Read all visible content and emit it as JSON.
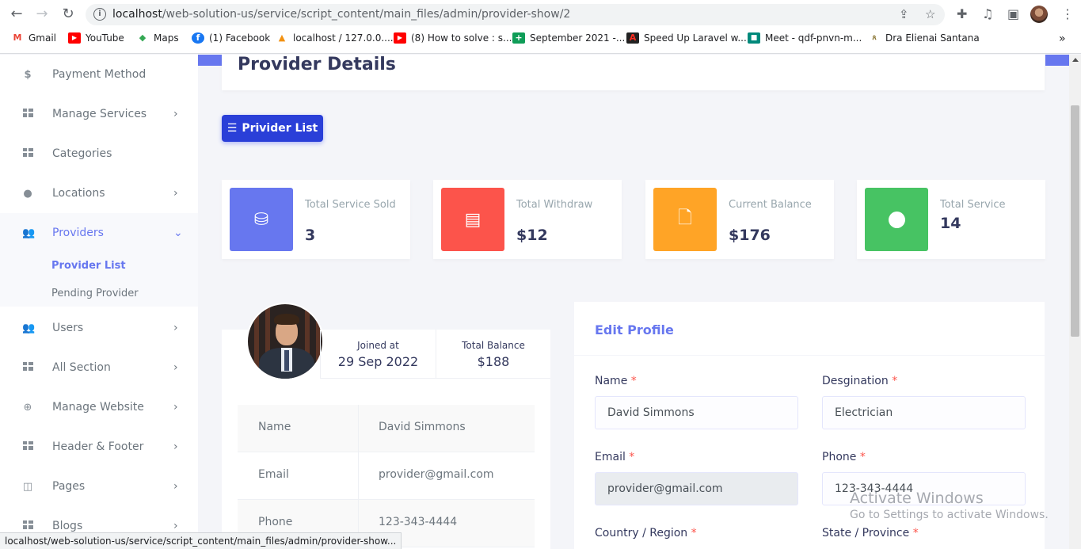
{
  "browser": {
    "url_host": "localhost",
    "url_path": "/web-solution-us/service/script_content/main_files/admin/provider-show/2",
    "bookmarks": [
      {
        "label": "Gmail",
        "icon": "gmail-icon"
      },
      {
        "label": "YouTube",
        "icon": "youtube-icon"
      },
      {
        "label": "Maps",
        "icon": "maps-icon"
      },
      {
        "label": "(1) Facebook",
        "icon": "facebook-icon"
      },
      {
        "label": "localhost / 127.0.0....",
        "icon": "phpmyadmin-icon"
      },
      {
        "label": "(8) How to solve : s...",
        "icon": "youtube-icon"
      },
      {
        "label": "September 2021 -...",
        "icon": "sheets-icon"
      },
      {
        "label": "Speed Up Laravel w...",
        "icon": "laravel-icon"
      },
      {
        "label": "Meet - qdf-pnvn-m...",
        "icon": "meet-icon"
      },
      {
        "label": "Dra Elienai Santana",
        "icon": "site-icon"
      }
    ],
    "bookmarks_more": "»",
    "status_url": "localhost/web-solution-us/service/script_content/main_files/admin/provider-show..."
  },
  "sidebar": {
    "items": [
      {
        "label": "Payment Method",
        "icon": "dollar-icon"
      },
      {
        "label": "Manage Services",
        "icon": "grid-icon"
      },
      {
        "label": "Categories",
        "icon": "grid-icon"
      },
      {
        "label": "Locations",
        "icon": "map-pin-icon"
      },
      {
        "label": "Providers",
        "icon": "users-icon"
      },
      {
        "label": "Users",
        "icon": "users-icon"
      },
      {
        "label": "All Section",
        "icon": "grid-icon"
      },
      {
        "label": "Manage Website",
        "icon": "globe-icon"
      },
      {
        "label": "Header & Footer",
        "icon": "grid-icon"
      },
      {
        "label": "Pages",
        "icon": "columns-icon"
      },
      {
        "label": "Blogs",
        "icon": "grid-icon"
      }
    ],
    "sub_items": [
      {
        "label": "Provider List"
      },
      {
        "label": "Pending Provider"
      }
    ]
  },
  "page": {
    "title": "Provider Details",
    "list_button": "Privider List"
  },
  "stats": [
    {
      "label": "Total Service Sold",
      "value": "3",
      "color": "#6777ef",
      "icon": "coins-icon"
    },
    {
      "label": "Total Withdraw",
      "value": "$12",
      "color": "#fc544b",
      "icon": "newspaper-icon"
    },
    {
      "label": "Current Balance",
      "value": "$176",
      "color": "#ffa426",
      "icon": "file-icon"
    },
    {
      "label": "Total Service",
      "value": "14",
      "color": "#47c363",
      "icon": "circle-icon"
    }
  ],
  "profile": {
    "joined_label": "Joined at",
    "joined_value": "29 Sep 2022",
    "balance_label": "Total Balance",
    "balance_value": "$188",
    "rows": [
      {
        "key": "Name",
        "value": "David Simmons"
      },
      {
        "key": "Email",
        "value": "provider@gmail.com"
      },
      {
        "key": "Phone",
        "value": "123-343-4444"
      }
    ]
  },
  "edit": {
    "title": "Edit Profile",
    "name_label": "Name",
    "name_value": "David Simmons",
    "designation_label": "Desgination",
    "designation_value": "Electrician",
    "email_label": "Email",
    "email_value": "provider@gmail.com",
    "phone_label": "Phone",
    "phone_value": "123-343-4444",
    "country_label": "Country / Region",
    "state_label": "State / Province",
    "required_mark": "*"
  },
  "watermark": {
    "line1": "Activate Windows",
    "line2": "Go to Settings to activate Windows."
  }
}
